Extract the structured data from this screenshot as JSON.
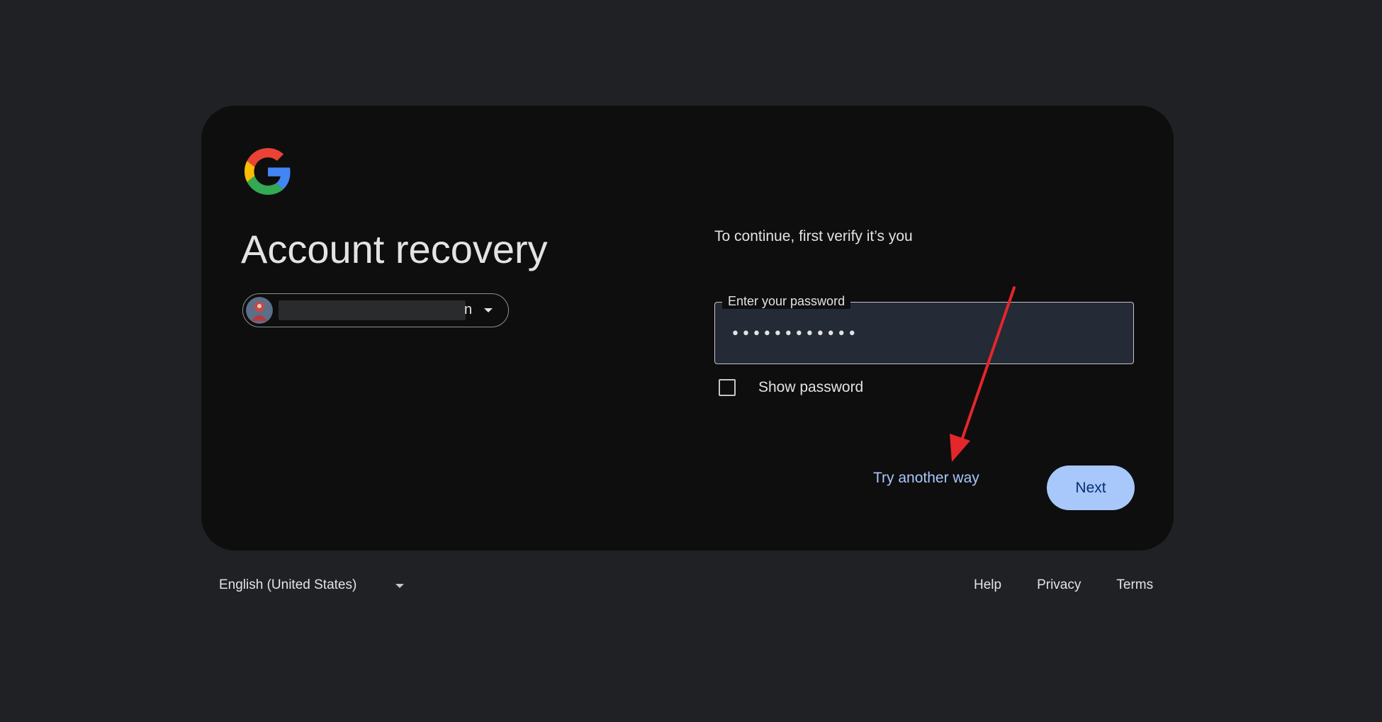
{
  "header": {
    "logo_icon": "google-g-logo",
    "title": "Account recovery"
  },
  "account": {
    "email_visible_tail": "n",
    "chevron_icon": "caret-down-icon"
  },
  "form": {
    "subtitle": "To continue, first verify it’s you",
    "password_label": "Enter your password",
    "password_value": "••••••••••••",
    "show_password_label": "Show password",
    "show_password_checked": false
  },
  "actions": {
    "try_another_way": "Try another way",
    "next": "Next"
  },
  "footer": {
    "language": "English (United States)",
    "links": [
      "Help",
      "Privacy",
      "Terms"
    ]
  },
  "colors": {
    "page_bg": "#1f2125",
    "card_bg": "#0e0e0f",
    "accent": "#a8c7fa",
    "annotation_arrow": "#e5262a"
  }
}
